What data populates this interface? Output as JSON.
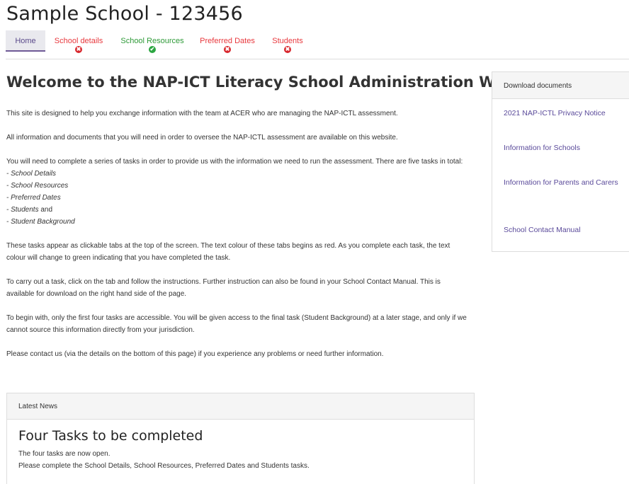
{
  "header": {
    "school_title": "Sample School - 123456"
  },
  "tabs": [
    {
      "label": "Home",
      "status": ""
    },
    {
      "label": "School details",
      "status": "✖"
    },
    {
      "label": "School Resources",
      "status": "✔"
    },
    {
      "label": "Preferred Dates",
      "status": "✖"
    },
    {
      "label": "Students",
      "status": "✖"
    }
  ],
  "main": {
    "title": "Welcome to the NAP-ICT Literacy School Administration Website",
    "paragraphs": [
      "This site is designed to help you exchange information with the team at ACER who are managing the NAP-ICTL assessment.",
      "All information and documents that you will need in order to oversee the NAP-ICTL assessment are available on this website.",
      "You will need to complete a series of tasks in order to provide us with the information we need to run the assessment. There are five tasks in total:",
      "These tasks appear as clickable tabs at the top of the screen. The text colour of these tabs begins as red. As you complete each task, the text colour will change to green indicating that you have completed the task.",
      "To carry out a task, click on the tab and follow the instructions. Further instruction can also be found in your School Contact Manual. This is available for download on the right hand side of the page.",
      "To begin with, only the first four tasks are accessible. You will be given access to the final task (Student Background) at a later stage, and only if we cannot source this information directly from your jurisdiction.",
      "Please contact us (via the details on the bottom of this page) if you experience any problems or need further information."
    ],
    "task_list": [
      "School Details",
      "School Resources",
      "Preferred Dates",
      "Students",
      "Student Background"
    ],
    "task_and": "and"
  },
  "news": {
    "header": "Latest News",
    "title": "Four Tasks to be completed",
    "lines": [
      "The four tasks are now open.",
      "Please complete the School Details, School Resources, Preferred Dates and Students tasks."
    ]
  },
  "docs": {
    "header": "Download documents",
    "links": [
      "2021 NAP-ICTL Privacy Notice",
      "Information for Schools",
      "Information for Parents and Carers",
      "School Contact Manual"
    ]
  },
  "colors": {
    "incomplete": "#e8383d",
    "complete": "#2e9a38",
    "link": "#5a4a9a",
    "active_tab_border": "#6f5a96"
  }
}
